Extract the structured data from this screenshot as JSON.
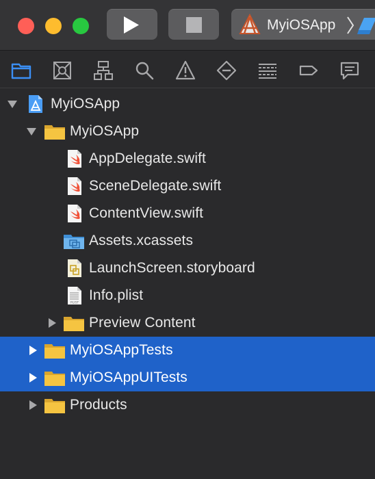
{
  "toolbar": {
    "scheme_label": "MyiOSApp",
    "run_icon": "play-icon",
    "stop_icon": "stop-icon"
  },
  "navigator_tabs": [
    {
      "name": "project-navigator",
      "icon": "folder-icon",
      "active": true
    },
    {
      "name": "source-control-navigator",
      "icon": "source-control-icon"
    },
    {
      "name": "symbol-navigator",
      "icon": "hierarchy-icon"
    },
    {
      "name": "find-navigator",
      "icon": "magnifier-icon"
    },
    {
      "name": "issue-navigator",
      "icon": "warning-icon"
    },
    {
      "name": "test-navigator",
      "icon": "diamond-icon"
    },
    {
      "name": "debug-navigator",
      "icon": "list-icon"
    },
    {
      "name": "breakpoint-navigator",
      "icon": "tag-icon"
    },
    {
      "name": "report-navigator",
      "icon": "message-icon"
    }
  ],
  "tree": [
    {
      "label": "MyiOSApp",
      "icon": "xcode-project-icon",
      "expanded": true
    },
    {
      "label": "MyiOSApp",
      "icon": "folder-icon",
      "expanded": true
    },
    {
      "label": "AppDelegate.swift",
      "icon": "swift-file-icon"
    },
    {
      "label": "SceneDelegate.swift",
      "icon": "swift-file-icon"
    },
    {
      "label": "ContentView.swift",
      "icon": "swift-file-icon"
    },
    {
      "label": "Assets.xcassets",
      "icon": "asset-catalog-icon"
    },
    {
      "label": "LaunchScreen.storyboard",
      "icon": "storyboard-icon"
    },
    {
      "label": "Info.plist",
      "icon": "plist-icon",
      "icon_text": "PLIST"
    },
    {
      "label": "Preview Content",
      "icon": "folder-icon",
      "expanded": false
    },
    {
      "label": "MyiOSAppTests",
      "icon": "folder-icon",
      "expanded": false,
      "selected": true
    },
    {
      "label": "MyiOSAppUITests",
      "icon": "folder-icon",
      "expanded": false,
      "selected": true
    },
    {
      "label": "Products",
      "icon": "folder-icon",
      "expanded": false
    }
  ],
  "colors": {
    "selection": "#1f62c9",
    "folder": "#f5c441",
    "swift": "#f05138",
    "accent": "#3b8ff5"
  }
}
